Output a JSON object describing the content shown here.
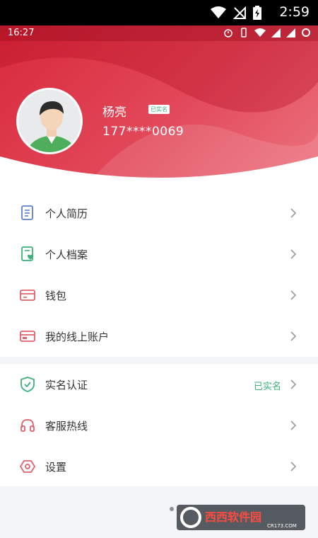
{
  "system_bar": {
    "time": "2:59"
  },
  "inner_status_bar": {
    "time": "16:27"
  },
  "profile": {
    "name": "杨亮",
    "verified_badge": "已实名",
    "phone": "177****0069"
  },
  "menu_group_1": [
    {
      "label": "个人简历",
      "icon": "resume-icon"
    },
    {
      "label": "个人档案",
      "icon": "profile-file-icon"
    },
    {
      "label": "钱包",
      "icon": "wallet-icon"
    },
    {
      "label": "我的线上账户",
      "icon": "online-account-icon"
    }
  ],
  "menu_group_2": [
    {
      "label": "实名认证",
      "icon": "shield-icon",
      "status": "已实名"
    },
    {
      "label": "客服热线",
      "icon": "headset-icon"
    },
    {
      "label": "设置",
      "icon": "settings-icon"
    }
  ],
  "watermark": {
    "text": "西西软件园",
    "subtext": "CR173.COM"
  },
  "colors": {
    "accent_red": "#d8293c",
    "verified_green": "#3bb07a",
    "icon_red": "#e0606c",
    "icon_blue": "#5b7fd6"
  }
}
